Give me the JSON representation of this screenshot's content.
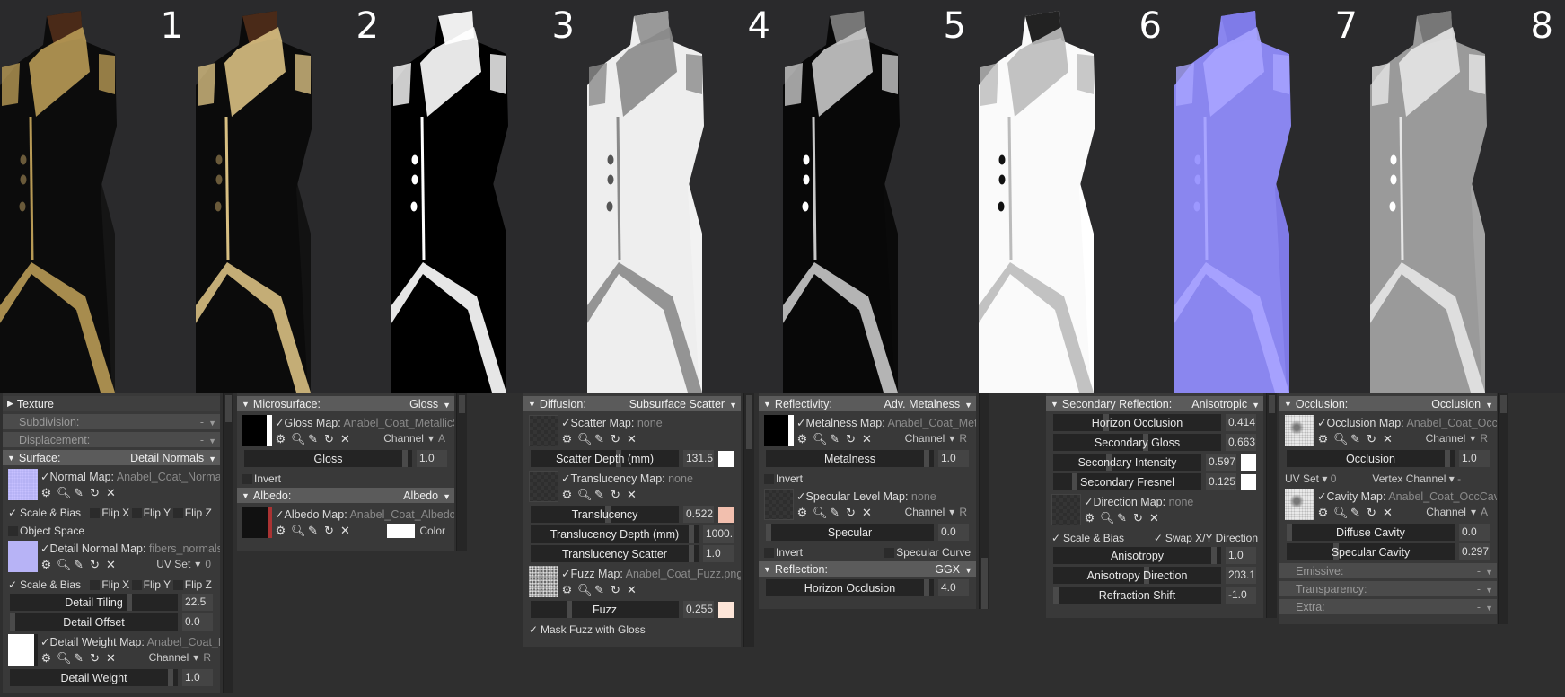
{
  "renders": [
    {
      "label": "1",
      "style": "final"
    },
    {
      "label": "2",
      "style": "albedo-trim"
    },
    {
      "label": "3",
      "style": "metalness"
    },
    {
      "label": "4",
      "style": "gloss"
    },
    {
      "label": "5",
      "style": "checker-mask"
    },
    {
      "label": "6",
      "style": "checker-white"
    },
    {
      "label": "7",
      "style": "normal"
    },
    {
      "label": "8",
      "style": "occlusion"
    }
  ],
  "icons": [
    "gear-icon",
    "magnifier-icon",
    "pencil-icon",
    "refresh-icon",
    "close-icon"
  ],
  "panels": [
    {
      "name": "surface-panel",
      "rows": [
        {
          "type": "header",
          "variant": "plain",
          "title": "Texture",
          "arrow": "right"
        },
        {
          "type": "header",
          "variant": "disabled",
          "title": "Subdivision:",
          "value": "-"
        },
        {
          "type": "header",
          "variant": "disabled",
          "title": "Displacement:",
          "value": "-"
        },
        {
          "type": "header",
          "title": "Surface:",
          "value": "Detail Normals"
        },
        {
          "type": "map",
          "thumb": "normal",
          "label": "Normal Map:",
          "file": "Anabel_Coat_Normal.png"
        },
        {
          "type": "checks",
          "layout": "grid4",
          "items": [
            {
              "label": "Scale & Bias",
              "checked": true
            },
            {
              "label": "Flip X",
              "checked": false
            },
            {
              "label": "Flip Y",
              "checked": false
            },
            {
              "label": "Flip Z",
              "checked": false
            }
          ]
        },
        {
          "type": "checks",
          "items": [
            {
              "label": "Object Space",
              "checked": false
            }
          ]
        },
        {
          "type": "map",
          "thumb": "lav",
          "label": "Detail Normal Map:",
          "file": "fibers_normals.png",
          "right": {
            "label": "UV Set",
            "value": "0"
          }
        },
        {
          "type": "checks",
          "layout": "grid4",
          "items": [
            {
              "label": "Scale & Bias",
              "checked": true
            },
            {
              "label": "Flip X",
              "checked": false
            },
            {
              "label": "Flip Y",
              "checked": false
            },
            {
              "label": "Flip Z",
              "checked": false
            }
          ]
        },
        {
          "type": "slider",
          "label": "Detail Tiling",
          "value": "22.5",
          "level": 0.72
        },
        {
          "type": "slider",
          "label": "Detail Offset",
          "value": "0.0",
          "level": 0.0
        },
        {
          "type": "map",
          "thumb": "white",
          "label": "Detail Weight Map:",
          "file": "Anabel_Coat_DetailM",
          "right": {
            "label": "Channel",
            "value": "R"
          }
        },
        {
          "type": "slider",
          "label": "Detail Weight",
          "value": "1.0",
          "level": 0.97
        }
      ]
    },
    {
      "name": "microsurface-panel",
      "rows": [
        {
          "type": "header",
          "title": "Microsurface:",
          "value": "Gloss"
        },
        {
          "type": "map",
          "thumb": "bw",
          "label": "Gloss Map:",
          "file": "Anabel_Coat_MetallicSmooth",
          "right": {
            "label": "Channel",
            "value": "A"
          }
        },
        {
          "type": "slider",
          "label": "Gloss",
          "value": "1.0",
          "level": 0.97
        },
        {
          "type": "checks",
          "items": [
            {
              "label": "Invert",
              "checked": false
            }
          ]
        },
        {
          "type": "header",
          "title": "Albedo:",
          "value": "Albedo"
        },
        {
          "type": "map",
          "thumb": "albedo",
          "label": "Albedo Map:",
          "file": "Anabel_Coat_AlbedoTransp",
          "color": {
            "label": "Color",
            "swatch": "#ffffff"
          }
        }
      ]
    },
    {
      "name": "diffusion-panel",
      "rows": [
        {
          "type": "header",
          "title": "Diffusion:",
          "value": "Subsurface Scatter"
        },
        {
          "type": "map",
          "thumb": "check",
          "label": "Scatter Map:",
          "file": "none"
        },
        {
          "type": "slider",
          "label": "Scatter Depth (mm)",
          "value": "131.5",
          "level": 0.6,
          "swatch": "#ffffff"
        },
        {
          "type": "map",
          "thumb": "check",
          "label": "Translucency Map:",
          "file": "none"
        },
        {
          "type": "slider",
          "label": "Translucency",
          "value": "0.522",
          "level": 0.52,
          "swatch": "#f2bfae"
        },
        {
          "type": "slider",
          "label": "Translucency Depth (mm)",
          "value": "1000.",
          "level": 0.97
        },
        {
          "type": "slider",
          "label": "Translucency Scatter",
          "value": "1.0",
          "level": 0.97
        },
        {
          "type": "map",
          "thumb": "noise",
          "label": "Fuzz Map:",
          "file": "Anabel_Coat_Fuzz.png"
        },
        {
          "type": "slider",
          "label": "Fuzz",
          "value": "0.255",
          "level": 0.25,
          "swatch": "#fde5d8"
        },
        {
          "type": "checks",
          "items": [
            {
              "label": "Mask Fuzz with Gloss",
              "checked": true
            }
          ]
        }
      ]
    },
    {
      "name": "reflectivity-panel",
      "rows": [
        {
          "type": "header",
          "title": "Reflectivity:",
          "value": "Adv. Metalness"
        },
        {
          "type": "map",
          "thumb": "bw",
          "label": "Metalness Map:",
          "file": "Anabel_Coat_MetallicSm",
          "right": {
            "label": "Channel",
            "value": "R"
          }
        },
        {
          "type": "slider",
          "label": "Metalness",
          "value": "1.0",
          "level": 0.97
        },
        {
          "type": "checks",
          "items": [
            {
              "label": "Invert",
              "checked": false
            }
          ]
        },
        {
          "type": "map",
          "thumb": "check",
          "label": "Specular Level Map:",
          "file": "none",
          "right": {
            "label": "Channel",
            "value": "R"
          }
        },
        {
          "type": "slider",
          "label": "Specular",
          "value": "0.0",
          "level": 0.0
        },
        {
          "type": "checks",
          "layout": "split",
          "items": [
            {
              "label": "Invert",
              "checked": false
            },
            {
              "label": "Specular Curve",
              "checked": false
            }
          ]
        },
        {
          "type": "header",
          "title": "Reflection:",
          "value": "GGX"
        },
        {
          "type": "slider",
          "label": "Horizon Occlusion",
          "value": "4.0",
          "level": 0.97
        }
      ]
    },
    {
      "name": "secondary-reflection-panel",
      "rows": [
        {
          "type": "header",
          "title": "Secondary Reflection:",
          "value": "Anisotropic"
        },
        {
          "type": "slider",
          "label": "Horizon Occlusion",
          "value": "0.414",
          "level": 0.31
        },
        {
          "type": "slider",
          "label": "Secondary Gloss",
          "value": "0.663",
          "level": 0.55
        },
        {
          "type": "slider",
          "label": "Secondary Intensity",
          "value": "0.597",
          "level": 0.37,
          "swatch": "#ffffff"
        },
        {
          "type": "slider",
          "label": "Secondary Fresnel",
          "value": "0.125",
          "level": 0.13,
          "swatch": "#ffffff"
        },
        {
          "type": "map",
          "thumb": "check",
          "label": "Direction Map:",
          "file": "none"
        },
        {
          "type": "checks",
          "layout": "split",
          "items": [
            {
              "label": "Scale & Bias",
              "checked": true
            },
            {
              "label": "Swap X/Y Direction",
              "checked": true
            }
          ]
        },
        {
          "type": "slider",
          "label": "Anisotropy",
          "value": "1.0",
          "level": 0.97
        },
        {
          "type": "slider",
          "label": "Anisotropy Direction",
          "value": "203.1",
          "level": 0.56
        },
        {
          "type": "slider",
          "label": "Refraction Shift",
          "value": "-1.0",
          "level": 0.0
        }
      ]
    },
    {
      "name": "occlusion-panel",
      "rows": [
        {
          "type": "header",
          "title": "Occlusion:",
          "value": "Occlusion"
        },
        {
          "type": "map",
          "thumb": "occ",
          "label": "Occlusion Map:",
          "file": "Anabel_Coat_OccCav.pr",
          "right": {
            "label": "Channel",
            "value": "R"
          }
        },
        {
          "type": "slider",
          "label": "Occlusion",
          "value": "1.0",
          "level": 0.97
        },
        {
          "type": "selects",
          "items": [
            {
              "label": "UV Set",
              "value": "0"
            },
            {
              "label": "Vertex Channel",
              "value": "-"
            }
          ]
        },
        {
          "type": "map",
          "thumb": "occ",
          "label": "Cavity Map:",
          "file": "Anabel_Coat_OccCav.png",
          "right": {
            "label": "Channel",
            "value": "A"
          }
        },
        {
          "type": "slider",
          "label": "Diffuse Cavity",
          "value": "0.0",
          "level": 0.0
        },
        {
          "type": "slider",
          "label": "Specular Cavity",
          "value": "0.297",
          "level": 0.29
        },
        {
          "type": "header",
          "variant": "disabled",
          "title": "Emissive:",
          "value": "-"
        },
        {
          "type": "header",
          "variant": "disabled",
          "title": "Transparency:",
          "value": "-"
        },
        {
          "type": "header",
          "variant": "disabled",
          "title": "Extra:",
          "value": "-"
        }
      ]
    }
  ]
}
